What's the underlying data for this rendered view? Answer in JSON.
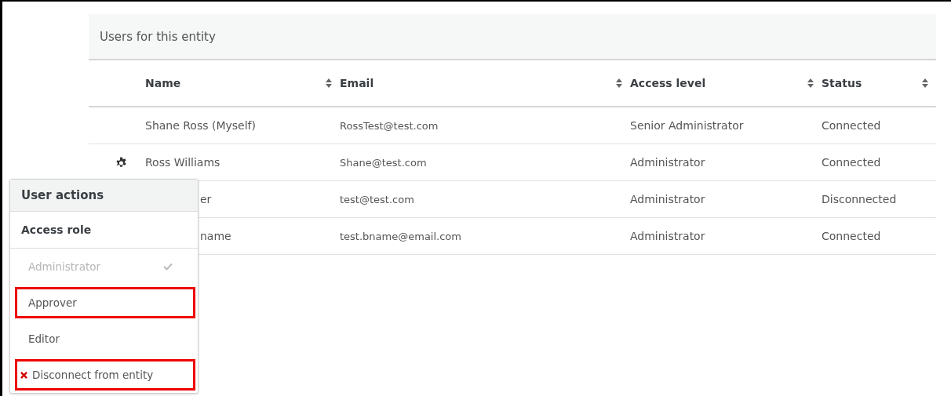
{
  "panel": {
    "title": "Users for this entity"
  },
  "table": {
    "columns": [
      {
        "label": "Name"
      },
      {
        "label": "Email"
      },
      {
        "label": "Access level"
      },
      {
        "label": "Status"
      }
    ],
    "rows": [
      {
        "name": "Shane Ross (Myself)",
        "email": "RossTest@test.com",
        "access": "Senior Administrator",
        "status": "Connected",
        "actions_open": false,
        "name_covered": false
      },
      {
        "name": "Ross Williams",
        "email": "Shane@test.com",
        "access": "Administrator",
        "status": "Connected",
        "actions_open": true,
        "name_covered": false
      },
      {
        "name": "er",
        "email": "test@test.com",
        "access": "Administrator",
        "status": "Disconnected",
        "actions_open": false,
        "name_covered": true
      },
      {
        "name": "name",
        "email": "test.bname@email.com",
        "access": "Administrator",
        "status": "Connected",
        "actions_open": false,
        "name_covered": true
      }
    ]
  },
  "menu": {
    "title": "User actions",
    "section": "Access role",
    "items": [
      {
        "kind": "role",
        "label": "Administrator",
        "checked": true,
        "highlighted": false
      },
      {
        "kind": "role",
        "label": "Approver",
        "checked": false,
        "highlighted": true
      },
      {
        "kind": "role",
        "label": "Editor",
        "checked": false,
        "highlighted": false
      },
      {
        "kind": "disconnect",
        "label": "Disconnect from entity",
        "checked": false,
        "highlighted": true
      }
    ]
  }
}
